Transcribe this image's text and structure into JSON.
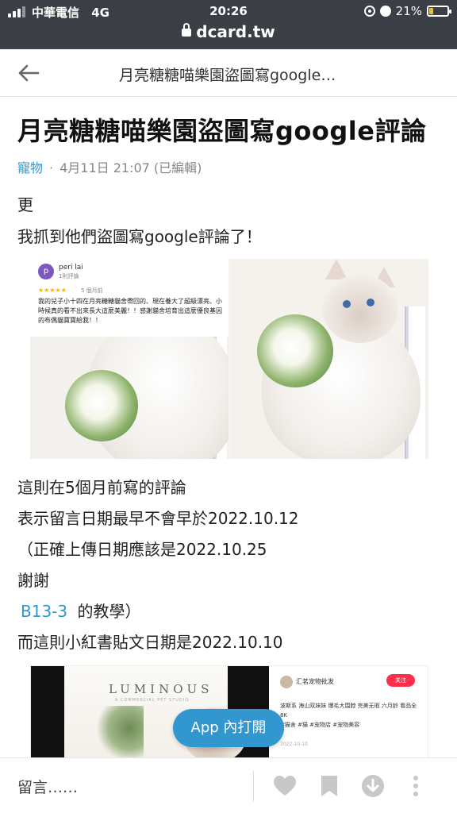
{
  "status_bar": {
    "carrier": "中華電信",
    "network": "4G",
    "time": "20:26",
    "battery_percent": "21%",
    "battery_level": 0.21,
    "url": "dcard.tw"
  },
  "nav": {
    "title": "月亮糖糖喵樂園盜圖寫google…"
  },
  "post": {
    "title": "月亮糖糖喵樂園盜圖寫google評論",
    "board": "寵物",
    "separator": "·",
    "date": "4月11日 21:07 (已編輯)",
    "line1": "更",
    "line2": "我抓到他們盜圖寫google評論了！",
    "line3": "這則在5個月前寫的評論",
    "line4": "表示留言日期最早不會早於2022.10.12",
    "line5": "（正確上傳日期應該是2022.10.25",
    "line6": "謝謝",
    "line7_link": "B13-3",
    "line7_rest": "的教學）",
    "line8": "而這則小紅書貼文日期是2022.10.10"
  },
  "image1": {
    "avatar_letter": "p",
    "reviewer": "peri lai",
    "reviewer_sub": "1則評論",
    "stars": "★★★★★",
    "when": "5 個月前",
    "review_text": "我的兒子小十四在月亮糖糖貓舍帶回的、現在養大了超級漂亮、小時候真的看不出來長大這麼美麗！！感謝貓舍培育出這麼優良基因的布偶貓寶寶給我！！"
  },
  "image2": {
    "brand": "LUMINOUS",
    "brand_sub": "A COMMERCIAL PET STUDIO",
    "account": "汇茗宠物批发",
    "follow": "关注",
    "body": "波斯系 海山双妹妹 爆毛大围脖 完美无瑕 六月龄 看品全 8K",
    "tags": "#猫舍 #猫 #宠物店 #宠物美容",
    "date": "2022-10-10"
  },
  "app_button": "App 內打開",
  "bottom": {
    "comment_placeholder": "留言……"
  },
  "colors": {
    "accent": "#3397cf",
    "status_bg": "#3b3f45",
    "battery": "#f4c21b"
  },
  "icons": [
    "back-arrow-icon",
    "heart-icon",
    "bookmark-icon",
    "download-icon",
    "more-vertical-icon",
    "lock-icon"
  ]
}
